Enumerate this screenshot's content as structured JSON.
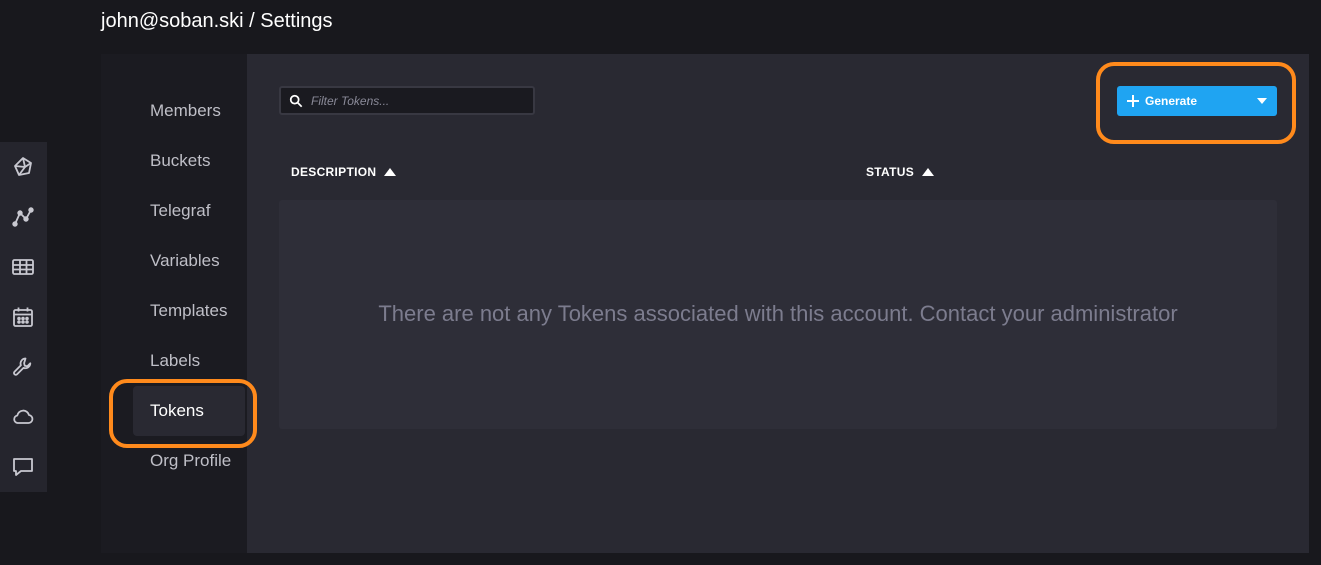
{
  "header": {
    "title": "john@soban.ski / Settings"
  },
  "icon_rail": {
    "items": [
      {
        "icon": "data-explorer-icon"
      },
      {
        "icon": "graph-icon"
      },
      {
        "icon": "dashboards-icon"
      },
      {
        "icon": "tasks-calendar-icon"
      },
      {
        "icon": "wrench-icon"
      },
      {
        "icon": "cloud-icon"
      },
      {
        "icon": "feedback-icon"
      }
    ]
  },
  "settings_nav": {
    "items": [
      {
        "label": "Members"
      },
      {
        "label": "Buckets"
      },
      {
        "label": "Telegraf"
      },
      {
        "label": "Variables"
      },
      {
        "label": "Templates"
      },
      {
        "label": "Labels"
      },
      {
        "label": "Tokens",
        "active": true
      },
      {
        "label": "Org Profile"
      }
    ]
  },
  "toolbar": {
    "filter_placeholder": "Filter Tokens...",
    "generate_label": "Generate"
  },
  "table": {
    "columns": [
      {
        "label": "DESCRIPTION",
        "sort": "ascending"
      },
      {
        "label": "STATUS",
        "sort": "ascending"
      }
    ],
    "empty_message": "There are not any Tokens associated with this account. Contact your administrator"
  },
  "colors": {
    "accent": "#1fa4f2",
    "highlight": "#ff8a1c",
    "background": "#18181d",
    "panel": "#292932"
  }
}
